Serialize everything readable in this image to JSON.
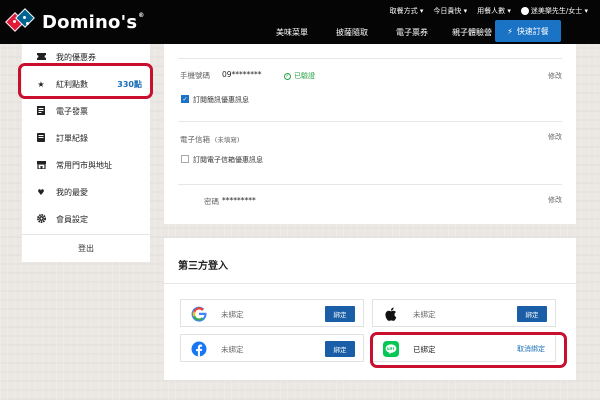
{
  "brand": {
    "name": "Domino's",
    "trademark": "®"
  },
  "utility_nav": [
    "取餐方式",
    "今日貴快",
    "用餐人數"
  ],
  "user": {
    "name": "迷美樂先生/女士"
  },
  "main_nav": [
    "美味菜單",
    "披薩隨取",
    "電子票券",
    "親子體驗營"
  ],
  "quick_order": {
    "label": "快速訂餐"
  },
  "sidebar": {
    "items": [
      {
        "label": "我的優惠券",
        "icon": "coupon-icon"
      },
      {
        "label": "紅利點數",
        "icon": "star-icon",
        "points": "330點"
      },
      {
        "label": "電子發票",
        "icon": "invoice-icon"
      },
      {
        "label": "訂單紀錄",
        "icon": "receipt-icon"
      },
      {
        "label": "常用門市與地址",
        "icon": "store-icon"
      },
      {
        "label": "我的最愛",
        "icon": "heart-icon"
      },
      {
        "label": "會員設定",
        "icon": "gear-icon"
      }
    ],
    "logout": "登出"
  },
  "profile": {
    "phone": {
      "label": "手機號碼",
      "value": "09********",
      "verified": "已驗證",
      "edit": "修改"
    },
    "sms_opt": {
      "label": "訂閱簡訊優惠訊息",
      "checked": true
    },
    "email": {
      "label": "電子信箱",
      "value": "(未填寫)",
      "edit": "修改"
    },
    "email_opt": {
      "label": "訂閱電子信箱優惠訊息",
      "checked": false
    },
    "password": {
      "label": "密碼",
      "value": "*********",
      "edit": "修改"
    }
  },
  "third_party": {
    "title": "第三方登入",
    "providers": [
      {
        "name": "google",
        "status": "未綁定",
        "action": "綁定"
      },
      {
        "name": "apple",
        "status": "未綁定",
        "action": "綁定"
      },
      {
        "name": "facebook",
        "status": "未綁定",
        "action": "綁定"
      },
      {
        "name": "line",
        "status": "已綁定",
        "action": "取消綁定"
      }
    ]
  },
  "colors": {
    "header_bg": "#050505",
    "accent_blue": "#1a73c4",
    "bind_button": "#1a5ea8",
    "points_text": "#1a6fb6",
    "verified_green": "#27a344",
    "highlight_red": "#c8102e",
    "line_green": "#06c755",
    "facebook_blue": "#1877f2",
    "brand_red": "#e31837",
    "brand_blue": "#006491"
  }
}
